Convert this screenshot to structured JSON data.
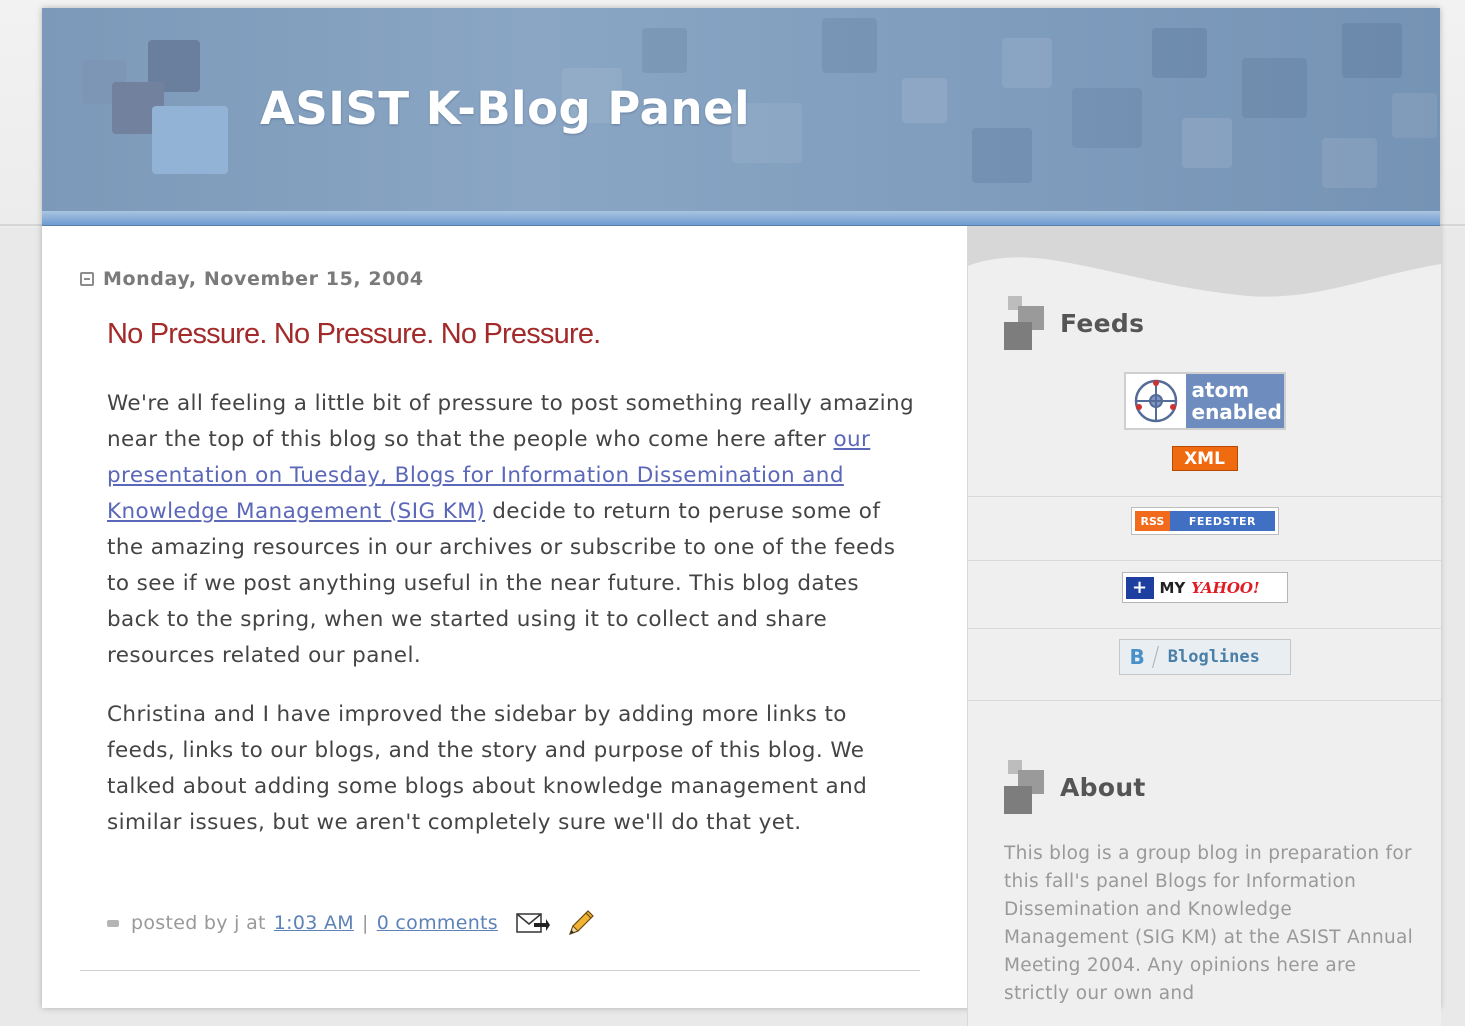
{
  "header": {
    "title": "ASIST K-Blog Panel"
  },
  "post": {
    "date": "Monday, November 15, 2004",
    "title": "No Pressure. No Pressure. No Pressure.",
    "p1_before_link": "We're all feeling a little bit of pressure to post something really amazing near the top of this blog so that the people who come here after ",
    "p1_link": "our presentation on Tuesday, Blogs for Information Dissemination and Knowledge Management (SIG KM)",
    "p1_after_link": " decide to return to peruse some of the amazing resources in our archives or subscribe to one of the feeds to see if we post anything useful in the near future. This blog dates back to the spring, when we started using it to collect and share resources related our panel.",
    "p2": "Christina and I have improved the sidebar by adding more links to feeds, links to our blogs, and the story and purpose of this blog. We talked about adding some blogs about knowledge management and similar issues, but we aren't completely sure we'll do that yet.",
    "footer": {
      "posted_by": "posted by j at",
      "time": "1:03 AM",
      "separator": "|",
      "comments": "0 comments"
    }
  },
  "sidebar": {
    "feeds": {
      "heading": "Feeds",
      "atom_line1": "atom",
      "atom_line2": "enabled",
      "xml": "XML",
      "rss": "RSS",
      "feedster": "FEEDSTER",
      "my": "MY",
      "yahoo": "YAHOO!",
      "bloglines_b": "B",
      "bloglines": "Bloglines"
    },
    "about": {
      "heading": "About",
      "text": "This blog is a group blog in preparation for this fall's panel Blogs for Information Dissemination and Knowledge Management (SIG KM) at the ASIST Annual Meeting 2004. Any opinions here are strictly our own and"
    }
  },
  "colors": {
    "header_blue": "#7f9cbd",
    "post_title": "#a32a2a",
    "link": "#5b67b8",
    "xml_orange": "#f06a0f"
  }
}
